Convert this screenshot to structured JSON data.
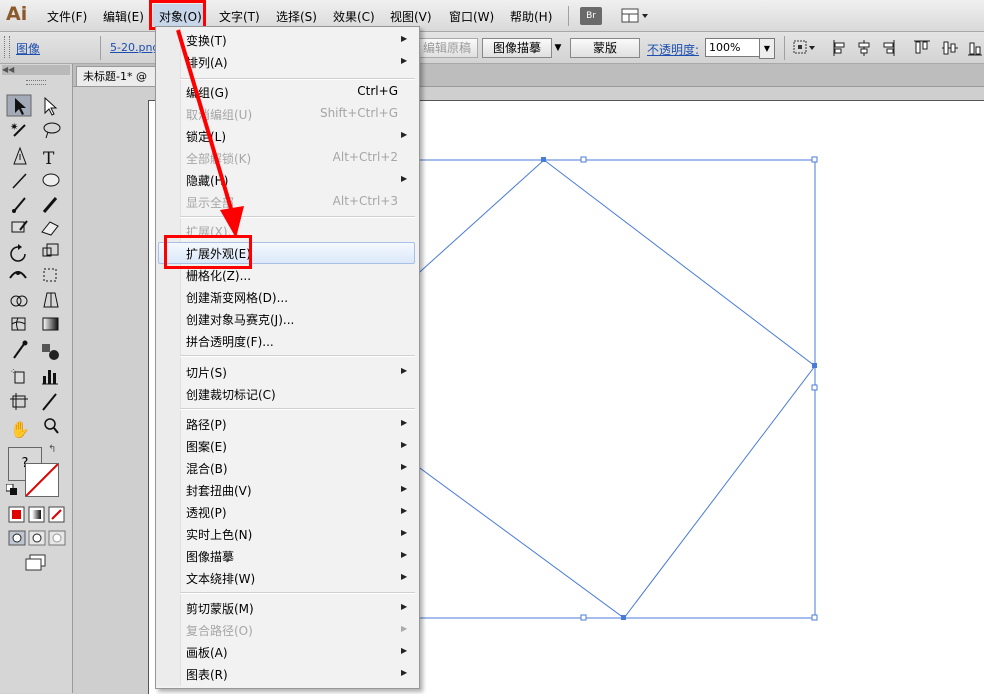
{
  "app": {
    "logo": "Ai"
  },
  "menubar": {
    "items": [
      "文件(F)",
      "编辑(E)",
      "对象(O)",
      "文字(T)",
      "选择(S)",
      "效果(C)",
      "视图(V)",
      "窗口(W)",
      "帮助(H)"
    ],
    "bridge_label": "Br"
  },
  "controlbar": {
    "panel_label": "图像",
    "file_name": "5-20.png",
    "embed_label": "编辑原稿",
    "trace_label": "图像描摹",
    "mask_label": "蒙版",
    "opacity_label": "不透明度:",
    "opacity_value": "100%"
  },
  "document": {
    "tab_title": "未标题-1* @"
  },
  "object_menu": {
    "items": [
      {
        "label": "变换(T)",
        "shortcut": "",
        "submenu": true,
        "disabled": false
      },
      {
        "label": "排列(A)",
        "shortcut": "",
        "submenu": true,
        "disabled": false
      },
      {
        "label": "编组(G)",
        "shortcut": "Ctrl+G",
        "submenu": false,
        "disabled": false
      },
      {
        "label": "取消编组(U)",
        "shortcut": "Shift+Ctrl+G",
        "submenu": false,
        "disabled": true
      },
      {
        "label": "锁定(L)",
        "shortcut": "",
        "submenu": true,
        "disabled": false
      },
      {
        "label": "全部解锁(K)",
        "shortcut": "Alt+Ctrl+2",
        "submenu": false,
        "disabled": true
      },
      {
        "label": "隐藏(H)",
        "shortcut": "",
        "submenu": true,
        "disabled": false
      },
      {
        "label": "显示全部",
        "shortcut": "Alt+Ctrl+3",
        "submenu": false,
        "disabled": true
      },
      {
        "label": "扩展(X)...",
        "shortcut": "",
        "submenu": false,
        "disabled": true
      },
      {
        "label": "扩展外观(E)",
        "shortcut": "",
        "submenu": false,
        "disabled": false
      },
      {
        "label": "栅格化(Z)...",
        "shortcut": "",
        "submenu": false,
        "disabled": false
      },
      {
        "label": "创建渐变网格(D)...",
        "shortcut": "",
        "submenu": false,
        "disabled": false
      },
      {
        "label": "创建对象马赛克(J)...",
        "shortcut": "",
        "submenu": false,
        "disabled": false
      },
      {
        "label": "拼合透明度(F)...",
        "shortcut": "",
        "submenu": false,
        "disabled": false
      },
      {
        "label": "切片(S)",
        "shortcut": "",
        "submenu": true,
        "disabled": false
      },
      {
        "label": "创建裁切标记(C)",
        "shortcut": "",
        "submenu": false,
        "disabled": false
      },
      {
        "label": "路径(P)",
        "shortcut": "",
        "submenu": true,
        "disabled": false
      },
      {
        "label": "图案(E)",
        "shortcut": "",
        "submenu": true,
        "disabled": false
      },
      {
        "label": "混合(B)",
        "shortcut": "",
        "submenu": true,
        "disabled": false
      },
      {
        "label": "封套扭曲(V)",
        "shortcut": "",
        "submenu": true,
        "disabled": false
      },
      {
        "label": "透视(P)",
        "shortcut": "",
        "submenu": true,
        "disabled": false
      },
      {
        "label": "实时上色(N)",
        "shortcut": "",
        "submenu": true,
        "disabled": false
      },
      {
        "label": "图像描摹",
        "shortcut": "",
        "submenu": true,
        "disabled": false
      },
      {
        "label": "文本绕排(W)",
        "shortcut": "",
        "submenu": true,
        "disabled": false
      },
      {
        "label": "剪切蒙版(M)",
        "shortcut": "",
        "submenu": true,
        "disabled": false
      },
      {
        "label": "复合路径(O)",
        "shortcut": "",
        "submenu": true,
        "disabled": true
      },
      {
        "label": "画板(A)",
        "shortcut": "",
        "submenu": true,
        "disabled": false
      },
      {
        "label": "图表(R)",
        "shortcut": "",
        "submenu": true,
        "disabled": false
      }
    ]
  },
  "toolbox": {
    "unknown_fill": "?"
  },
  "colors": {
    "accent": "#ff0000",
    "selection": "#4a7bd8"
  }
}
